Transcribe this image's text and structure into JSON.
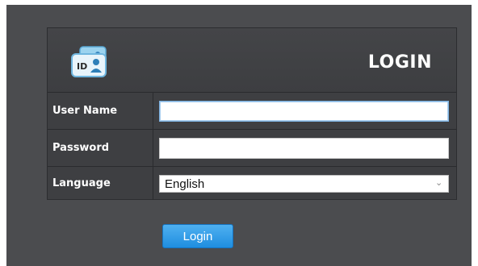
{
  "header": {
    "title": "LOGIN",
    "icon": "id-card-icon",
    "icon_text": "ID"
  },
  "form": {
    "username": {
      "label": "User Name",
      "value": "",
      "placeholder": ""
    },
    "password": {
      "label": "Password",
      "value": "",
      "placeholder": ""
    },
    "language": {
      "label": "Language",
      "selected": "English"
    }
  },
  "actions": {
    "login_label": "Login"
  },
  "colors": {
    "panel_bg": "#4b4c4f",
    "header_bg": "#3e3f42",
    "button": "#2a97e6",
    "text_light": "#ffffff"
  }
}
